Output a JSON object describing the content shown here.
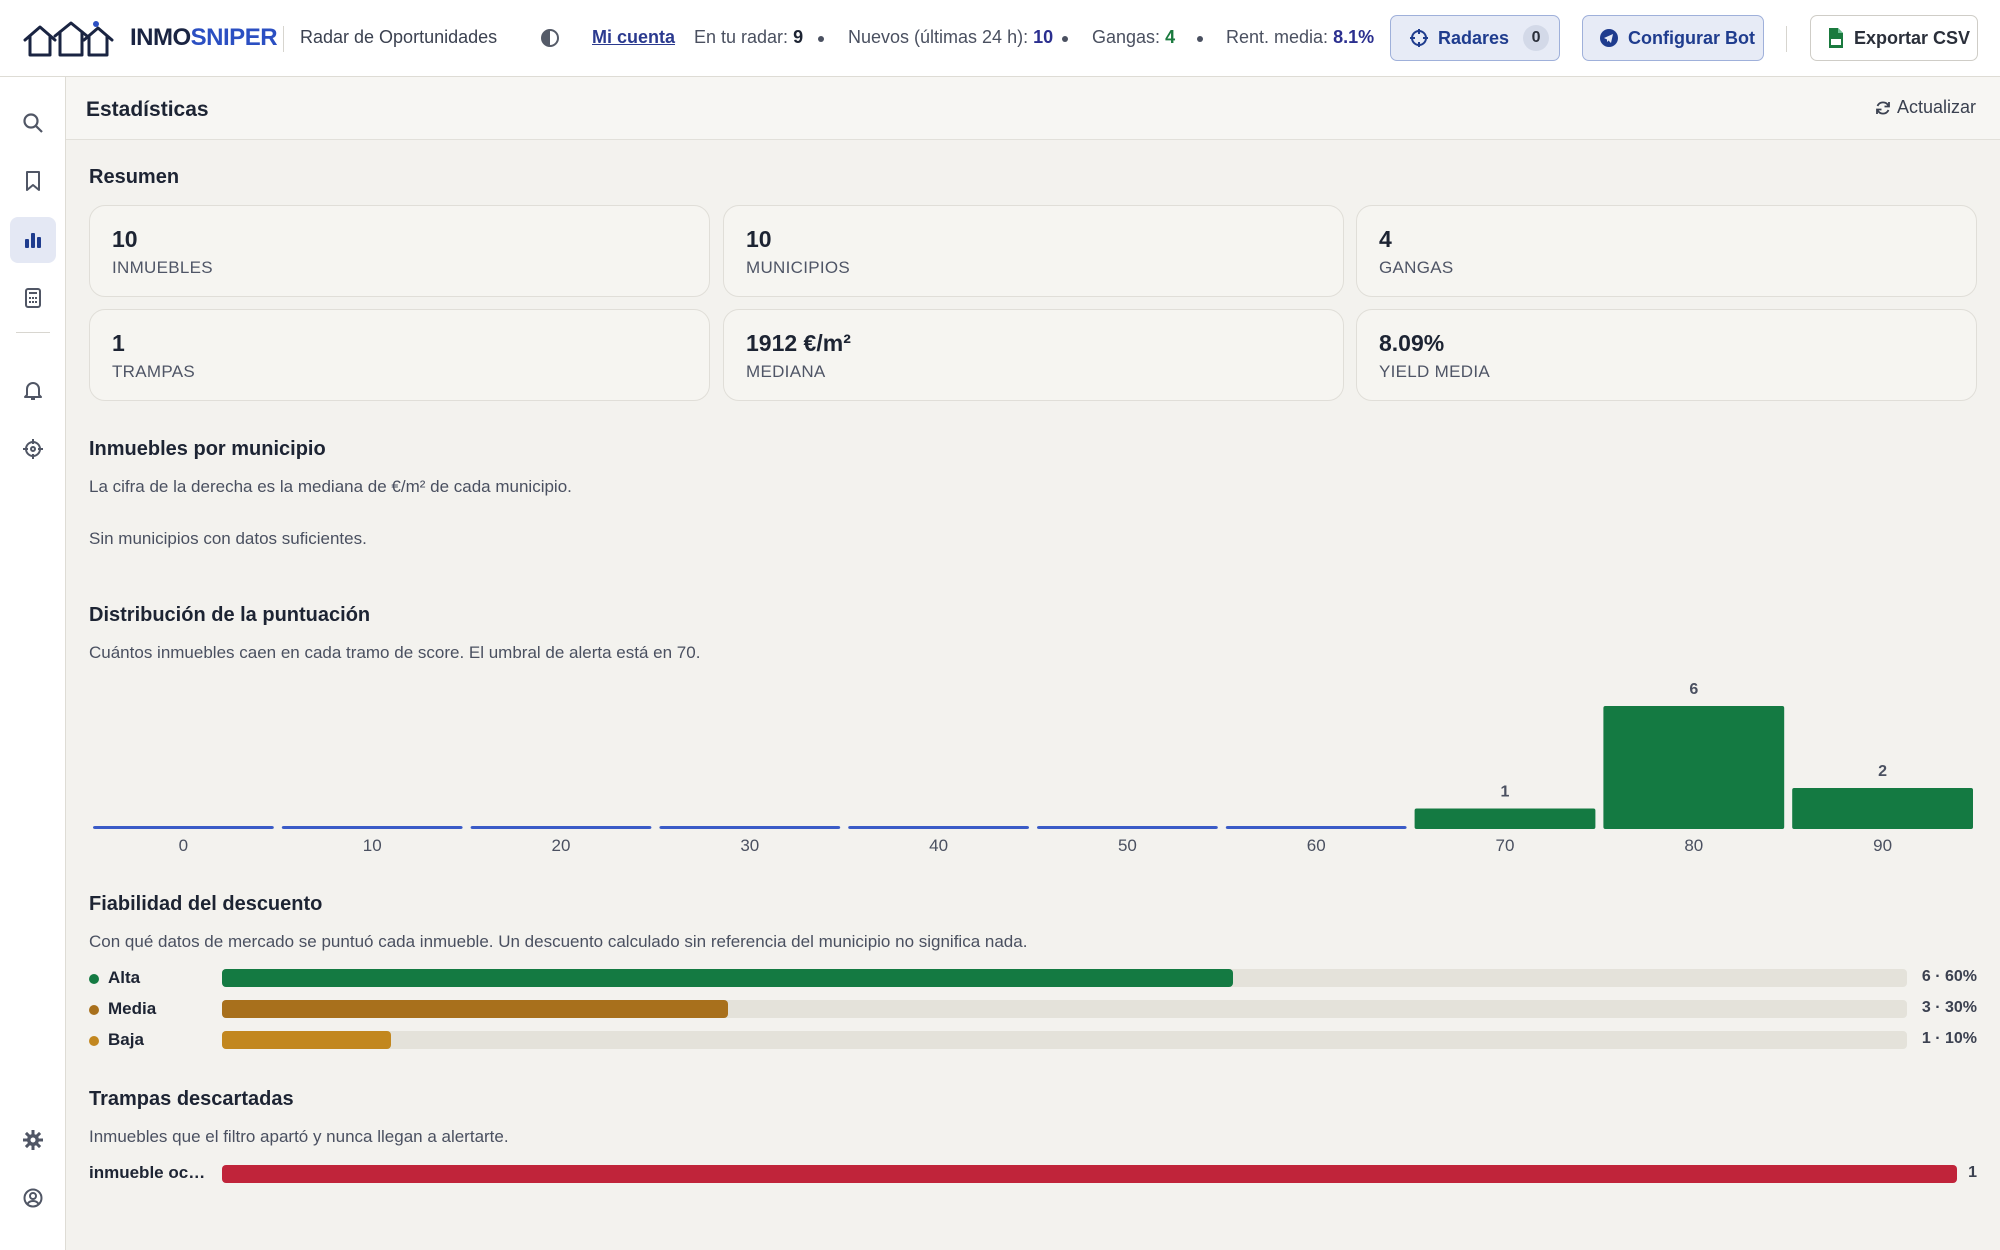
{
  "header": {
    "brand_part1": "INMO",
    "brand_part2": "SNIPER",
    "subtitle": "Radar de Oportunidades",
    "account_link": "Mi cuenta",
    "stats": [
      {
        "label": "En tu radar:",
        "value": "9",
        "color": "#1d2433"
      },
      {
        "label": "Nuevos (últimas 24 h):",
        "value": "10",
        "color": "#2b2f8f"
      },
      {
        "label": "Gangas:",
        "value": "4",
        "color": "#1a7a3e"
      },
      {
        "label": "Rent. media:",
        "value": "8.1%",
        "color": "#2b2f8f"
      }
    ],
    "radar_button": "Radares",
    "radar_count": "0",
    "bot_button": "Configurar Bot",
    "csv_button": "Exportar CSV"
  },
  "sidebar": {
    "items": [
      "search-icon",
      "bookmark-icon",
      "bar-chart-icon",
      "calculator-icon",
      "bell-icon",
      "crosshair-icon",
      "gear-icon",
      "user-circle-icon"
    ],
    "active": "bar-chart-icon"
  },
  "page": {
    "title": "Estadísticas",
    "refresh": "Actualizar"
  },
  "summary": {
    "title": "Resumen",
    "cards": [
      {
        "value": "10",
        "label": "INMUEBLES"
      },
      {
        "value": "10",
        "label": "MUNICIPIOS"
      },
      {
        "value": "4",
        "label": "GANGAS"
      },
      {
        "value": "1",
        "label": "TRAMPAS"
      },
      {
        "value": "1912 €/m²",
        "label": "MEDIANA"
      },
      {
        "value": "8.09%",
        "label": "YIELD MEDIA"
      }
    ]
  },
  "municipios": {
    "title": "Inmuebles por municipio",
    "subtitle": "La cifra de la derecha es la mediana de €/m² de cada municipio.",
    "empty": "Sin municipios con datos suficientes."
  },
  "distribution": {
    "title": "Distribución de la puntuación",
    "subtitle": "Cuántos inmuebles caen en cada tramo de score. El umbral de alerta está en 70."
  },
  "chart_data": {
    "type": "bar",
    "categories": [
      "0",
      "10",
      "20",
      "30",
      "40",
      "50",
      "60",
      "70",
      "80",
      "90"
    ],
    "values": [
      0,
      0,
      0,
      0,
      0,
      0,
      0,
      1,
      6,
      2
    ],
    "threshold": 70,
    "colors": {
      "below": "#3a5bc7",
      "above": "#147a42"
    }
  },
  "reliability": {
    "title": "Fiabilidad del descuento",
    "subtitle": "Con qué datos de mercado se puntuó cada inmueble. Un descuento calculado sin referencia del municipio no significa nada.",
    "rows": [
      {
        "label": "Alta",
        "value": "6 · 60%",
        "fraction": 0.6,
        "color": "#147a42"
      },
      {
        "label": "Media",
        "value": "3 · 30%",
        "fraction": 0.3,
        "color": "#a8701c"
      },
      {
        "label": "Baja",
        "value": "1 · 10%",
        "fraction": 0.1,
        "color": "#c2871f"
      }
    ]
  },
  "traps": {
    "title": "Trampas descartadas",
    "subtitle": "Inmuebles que el filtro apartó y nunca llegan a alertarte.",
    "rows": [
      {
        "label": "inmueble ocu…",
        "value": "1",
        "color": "#c0243a"
      }
    ]
  }
}
